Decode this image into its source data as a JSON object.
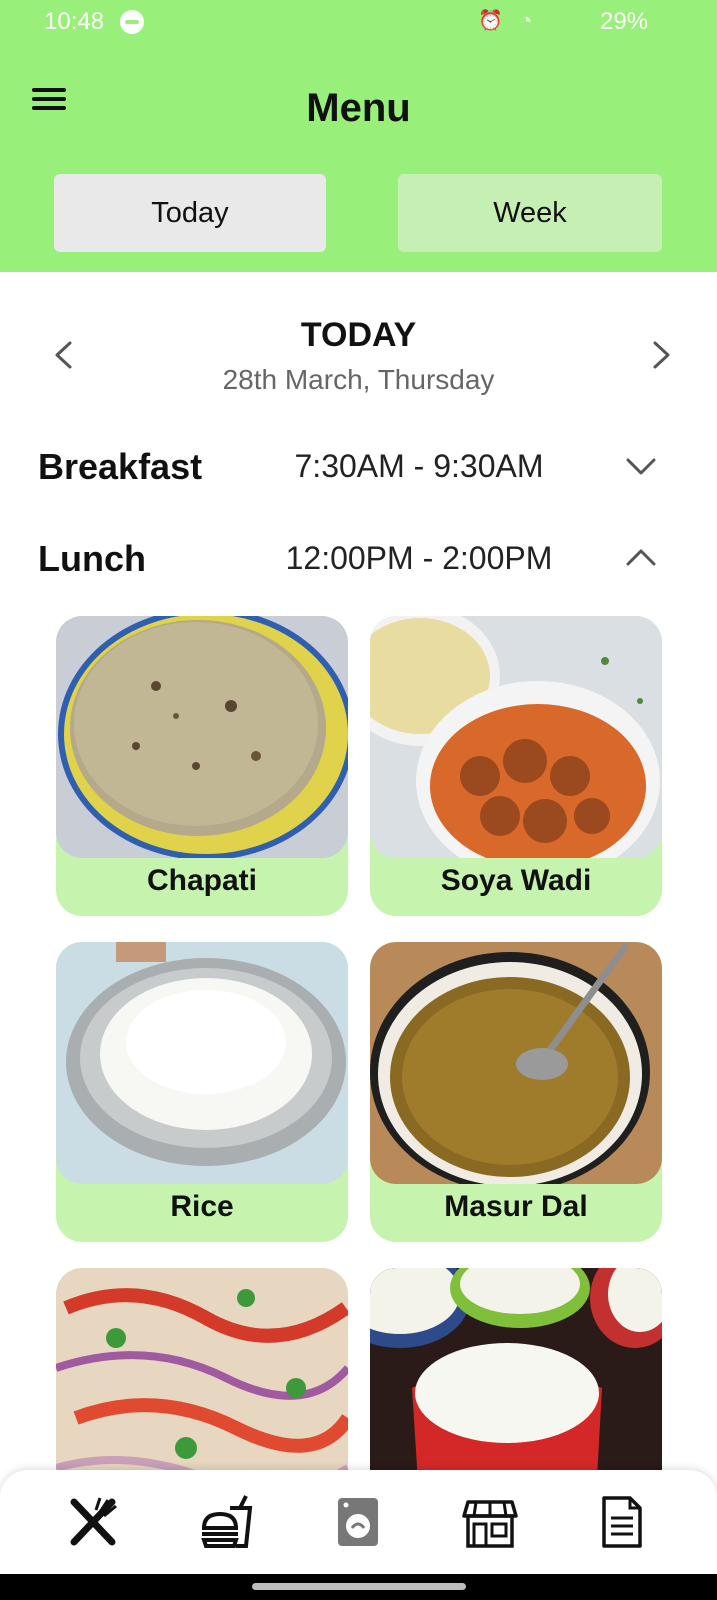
{
  "status_bar": {
    "time": "10:48",
    "battery": "29%"
  },
  "header": {
    "title": "Menu"
  },
  "tabs": [
    {
      "label": "Today",
      "selected": true
    },
    {
      "label": "Week",
      "selected": false
    }
  ],
  "day": {
    "title": "TODAY",
    "date": "28th March, Thursday"
  },
  "meals": [
    {
      "name": "Breakfast",
      "time": "7:30AM - 9:30AM",
      "expanded": false
    },
    {
      "name": "Lunch",
      "time": "12:00PM - 2:00PM",
      "expanded": true
    }
  ],
  "lunch_items": [
    {
      "label": "Chapati"
    },
    {
      "label": "Soya Wadi"
    },
    {
      "label": "Rice"
    },
    {
      "label": "Masur Dal"
    },
    {
      "label": ""
    },
    {
      "label": ""
    }
  ],
  "bottom_nav": [
    {
      "icon": "fork-knife-icon",
      "active": true
    },
    {
      "icon": "fast-food-icon",
      "active": false
    },
    {
      "icon": "washing-machine-icon",
      "active": false
    },
    {
      "icon": "store-icon",
      "active": false
    },
    {
      "icon": "document-icon",
      "active": false
    }
  ],
  "colors": {
    "header_green": "#98f07a",
    "card_green": "#c6f4ae",
    "week_tab": "#c6efb4",
    "today_tab": "#e9e9e9"
  }
}
